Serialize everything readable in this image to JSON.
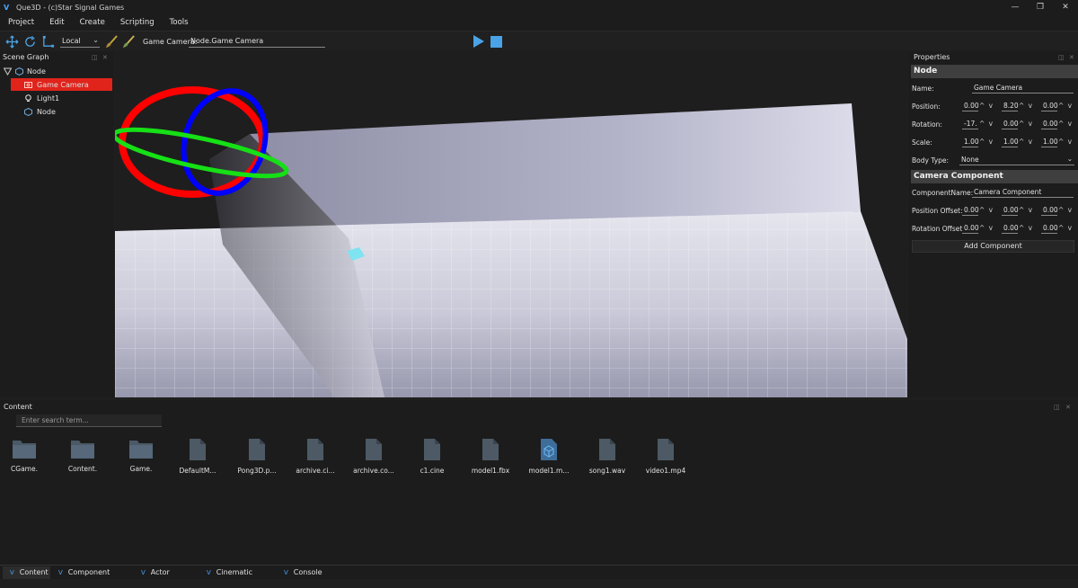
{
  "window": {
    "title": "Que3D - (c)Star Signal Games",
    "logo": "V"
  },
  "menu": [
    "Project",
    "Edit",
    "Create",
    "Scripting",
    "Tools"
  ],
  "toolbar": {
    "space": "Local",
    "camera_label": "Game Camera:",
    "camera_path": "Node.Game Camera",
    "icons": [
      "move-icon",
      "rotate-icon",
      "scale-icon",
      "paint-brush-icon",
      "paint-brush-icon",
      "play-icon",
      "stop-icon"
    ]
  },
  "scene_graph": {
    "title": "Scene Graph",
    "root": "Node",
    "items": [
      "Game Camera",
      "Light1",
      "Node"
    ]
  },
  "properties": {
    "title": "Properties",
    "node_section": "Node",
    "name_label": "Name:",
    "name_value": "Game Camera",
    "position_label": "Position:",
    "position": [
      "0.00",
      "8.20",
      "0.00"
    ],
    "rotation_label": "Rotation:",
    "rotation": [
      "-17.",
      "0.00",
      "0.00"
    ],
    "scale_label": "Scale:",
    "scale": [
      "1.00",
      "1.00",
      "1.00"
    ],
    "body_type_label": "Body Type:",
    "body_type": "None",
    "camera_section": "Camera Component",
    "component_name_label": "ComponentName:",
    "component_name": "Camera Component",
    "position_offset_label": "Position Offset:",
    "position_offset": [
      "0.00",
      "0.00",
      "0.00"
    ],
    "rotation_offset_label": "Rotation Offset",
    "rotation_offset": [
      "0.00",
      "0.00",
      "0.00"
    ],
    "add_component": "Add Component",
    "spin_glyph": "^ v"
  },
  "content": {
    "title": "Content",
    "search_placeholder": "Enter search term...",
    "assets": [
      {
        "label": "CGame.",
        "icon": "folder"
      },
      {
        "label": "Content.",
        "icon": "folder"
      },
      {
        "label": "Game.",
        "icon": "folder"
      },
      {
        "label": "DefaultM...",
        "icon": "file"
      },
      {
        "label": "Pong3D.p...",
        "icon": "file"
      },
      {
        "label": "archive.ci...",
        "icon": "file"
      },
      {
        "label": "archive.co...",
        "icon": "file"
      },
      {
        "label": "c1.cine",
        "icon": "file"
      },
      {
        "label": "model1.fbx",
        "icon": "file"
      },
      {
        "label": "model1.m...",
        "icon": "model"
      },
      {
        "label": "song1.wav",
        "icon": "file"
      },
      {
        "label": "video1.mp4",
        "icon": "file"
      }
    ]
  },
  "tabs": [
    "Content",
    "Component Content",
    "Actor Content",
    "Cinematic Editor",
    "Console"
  ],
  "colors": {
    "selection": "#e0241c",
    "accent": "#4aa3e6",
    "gizmo_x": "#ff0000",
    "gizmo_y": "#00ff00",
    "gizmo_z": "#0000ff"
  }
}
